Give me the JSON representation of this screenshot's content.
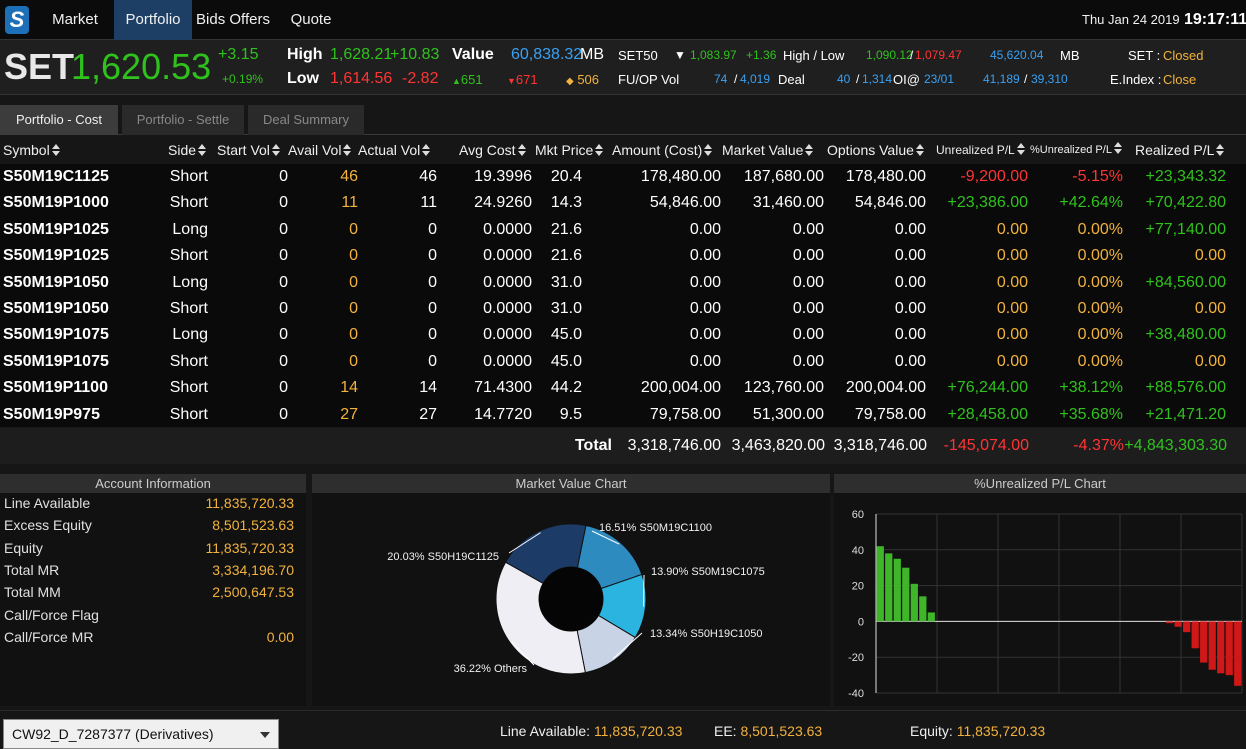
{
  "nav": {
    "logo": "S",
    "tabs": [
      {
        "label": "Market"
      },
      {
        "label": "Portfolio"
      },
      {
        "label": "Bids Offers"
      },
      {
        "label": "Quote"
      }
    ],
    "date": "Thu Jan 24 2019",
    "time": "19:17:11"
  },
  "ticker": {
    "index_name": "SET",
    "index_value": "1,620.53",
    "change": "+3.15",
    "change_pct": "+0.19%",
    "high_label": "High",
    "high_value": "1,628.21",
    "high_change": "+10.83",
    "low_label": "Low",
    "low_value": "1,614.56",
    "low_change": "-2.82",
    "value_label": "Value",
    "value_amount": "60,838.32",
    "value_unit": "MB",
    "up_count": "651",
    "down_count": "671",
    "unchanged_count": "506",
    "set50_label": "SET50",
    "set50_value": "1,083.97",
    "set50_change": "+1.36",
    "hl_label": "High / Low",
    "hl_high": "1,090.12",
    "hl_low": "1,079.47",
    "mb_value": "45,620.04",
    "mb_unit": "MB",
    "set_status_label": "SET :",
    "set_status": "Closed",
    "fuop_label": "FU/OP Vol",
    "fuop_vol1": "74",
    "fuop_vol2": "4,019",
    "deal_label": "Deal",
    "deal1": "40",
    "deal2": "1,314",
    "oi_label": "OI@",
    "oi_date": "23/01",
    "oi1": "41,189",
    "oi2": "39,310",
    "eindex_label": "E.Index :",
    "eindex_status": "Close"
  },
  "subtabs": [
    {
      "label": "Portfolio - Cost"
    },
    {
      "label": "Portfolio - Settle"
    },
    {
      "label": "Deal Summary"
    }
  ],
  "columns": {
    "symbol": "Symbol",
    "side": "Side",
    "start_vol": "Start Vol",
    "avail_vol": "Avail Vol",
    "actual_vol": "Actual Vol",
    "avg_cost": "Avg Cost",
    "mkt_price": "Mkt Price",
    "amount_cost": "Amount (Cost)",
    "market_value": "Market Value",
    "options_value": "Options Value",
    "unrealized_pl": "Unrealized P/L",
    "unrealized_pct": "%Unrealized P/L",
    "realized_pl": "Realized P/L"
  },
  "rows": [
    {
      "symbol": "S50M19C1125",
      "side": "Short",
      "start": "0",
      "avail": "46",
      "actual": "46",
      "avg": "19.3996",
      "mkt": "20.4",
      "amount": "178,480.00",
      "mv": "187,680.00",
      "ov": "178,480.00",
      "upl": "-9,200.00",
      "upct": "-5.15%",
      "rpl": "+23,343.32",
      "upl_c": "r",
      "upct_c": "r",
      "rpl_c": "g"
    },
    {
      "symbol": "S50M19P1000",
      "side": "Short",
      "start": "0",
      "avail": "11",
      "actual": "11",
      "avg": "24.9260",
      "mkt": "14.3",
      "amount": "54,846.00",
      "mv": "31,460.00",
      "ov": "54,846.00",
      "upl": "+23,386.00",
      "upct": "+42.64%",
      "rpl": "+70,422.80",
      "upl_c": "g",
      "upct_c": "g",
      "rpl_c": "g"
    },
    {
      "symbol": "S50M19P1025",
      "side": "Long",
      "start": "0",
      "avail": "0",
      "actual": "0",
      "avg": "0.0000",
      "mkt": "21.6",
      "amount": "0.00",
      "mv": "0.00",
      "ov": "0.00",
      "upl": "0.00",
      "upct": "0.00%",
      "rpl": "+77,140.00",
      "upl_c": "y",
      "upct_c": "y",
      "rpl_c": "g"
    },
    {
      "symbol": "S50M19P1025",
      "side": "Short",
      "start": "0",
      "avail": "0",
      "actual": "0",
      "avg": "0.0000",
      "mkt": "21.6",
      "amount": "0.00",
      "mv": "0.00",
      "ov": "0.00",
      "upl": "0.00",
      "upct": "0.00%",
      "rpl": "0.00",
      "upl_c": "y",
      "upct_c": "y",
      "rpl_c": "y"
    },
    {
      "symbol": "S50M19P1050",
      "side": "Long",
      "start": "0",
      "avail": "0",
      "actual": "0",
      "avg": "0.0000",
      "mkt": "31.0",
      "amount": "0.00",
      "mv": "0.00",
      "ov": "0.00",
      "upl": "0.00",
      "upct": "0.00%",
      "rpl": "+84,560.00",
      "upl_c": "y",
      "upct_c": "y",
      "rpl_c": "g"
    },
    {
      "symbol": "S50M19P1050",
      "side": "Short",
      "start": "0",
      "avail": "0",
      "actual": "0",
      "avg": "0.0000",
      "mkt": "31.0",
      "amount": "0.00",
      "mv": "0.00",
      "ov": "0.00",
      "upl": "0.00",
      "upct": "0.00%",
      "rpl": "0.00",
      "upl_c": "y",
      "upct_c": "y",
      "rpl_c": "y"
    },
    {
      "symbol": "S50M19P1075",
      "side": "Long",
      "start": "0",
      "avail": "0",
      "actual": "0",
      "avg": "0.0000",
      "mkt": "45.0",
      "amount": "0.00",
      "mv": "0.00",
      "ov": "0.00",
      "upl": "0.00",
      "upct": "0.00%",
      "rpl": "+38,480.00",
      "upl_c": "y",
      "upct_c": "y",
      "rpl_c": "g"
    },
    {
      "symbol": "S50M19P1075",
      "side": "Short",
      "start": "0",
      "avail": "0",
      "actual": "0",
      "avg": "0.0000",
      "mkt": "45.0",
      "amount": "0.00",
      "mv": "0.00",
      "ov": "0.00",
      "upl": "0.00",
      "upct": "0.00%",
      "rpl": "0.00",
      "upl_c": "y",
      "upct_c": "y",
      "rpl_c": "y"
    },
    {
      "symbol": "S50M19P1100",
      "side": "Short",
      "start": "0",
      "avail": "14",
      "actual": "14",
      "avg": "71.4300",
      "mkt": "44.2",
      "amount": "200,004.00",
      "mv": "123,760.00",
      "ov": "200,004.00",
      "upl": "+76,244.00",
      "upct": "+38.12%",
      "rpl": "+88,576.00",
      "upl_c": "g",
      "upct_c": "g",
      "rpl_c": "g"
    },
    {
      "symbol": "S50M19P975",
      "side": "Short",
      "start": "0",
      "avail": "27",
      "actual": "27",
      "avg": "14.7720",
      "mkt": "9.5",
      "amount": "79,758.00",
      "mv": "51,300.00",
      "ov": "79,758.00",
      "upl": "+28,458.00",
      "upct": "+35.68%",
      "rpl": "+21,471.20",
      "upl_c": "g",
      "upct_c": "g",
      "rpl_c": "g"
    }
  ],
  "totals": {
    "label": "Total",
    "amount": "3,318,746.00",
    "mv": "3,463,820.00",
    "ov": "3,318,746.00",
    "upl": "-145,074.00",
    "upct": "-4.37%",
    "rpl": "+4,843,303.30"
  },
  "account": {
    "title": "Account Information",
    "items": [
      {
        "label": "Line Available",
        "value": "11,835,720.33"
      },
      {
        "label": "Excess Equity",
        "value": "8,501,523.63"
      },
      {
        "label": "Equity",
        "value": "11,835,720.33"
      },
      {
        "label": "Total MR",
        "value": "3,334,196.70"
      },
      {
        "label": "Total MM",
        "value": "2,500,647.53"
      },
      {
        "label": "Call/Force Flag",
        "value": ""
      },
      {
        "label": "Call/Force MR",
        "value": "0.00"
      }
    ]
  },
  "chart_data": [
    {
      "type": "pie",
      "title": "Market Value Chart",
      "labels": [
        "16.51% S50M19C1100",
        "13.90% S50M19C1075",
        "13.34% S50H19C1050",
        "36.22% Others",
        "20.03% S50H19C1125"
      ],
      "values": [
        16.51,
        13.9,
        13.34,
        36.22,
        20.03
      ],
      "colors": [
        "#2e8bc0",
        "#2bb4e0",
        "#c8d4e6",
        "#eeeef4",
        "#1c3b66"
      ]
    },
    {
      "type": "bar",
      "title": "%Unrealized P/L Chart",
      "ylim": [
        -40,
        60
      ],
      "yticks": [
        "60",
        "40",
        "20",
        "0",
        "-20",
        "-40"
      ],
      "values": [
        42,
        38,
        35,
        30,
        21,
        14,
        5,
        0,
        0,
        0,
        0,
        0,
        0,
        0,
        0,
        0,
        0,
        0,
        0,
        0,
        0,
        0,
        0,
        0,
        0,
        0,
        0,
        0,
        0,
        0,
        0,
        0,
        0,
        0,
        -1,
        -3,
        -6,
        -15,
        -23,
        -27,
        -29,
        -30,
        -36
      ],
      "positive_color": "#3fb52a",
      "negative_color": "#d01818"
    }
  ],
  "footer": {
    "account_select": "CW92_D_7287377 (Derivatives)",
    "line_available_label": "Line Available:",
    "line_available_value": "11,835,720.33",
    "ee_label": "EE:",
    "ee_value": "8,501,523.63",
    "equity_label": "Equity:",
    "equity_value": "11,835,720.33"
  }
}
